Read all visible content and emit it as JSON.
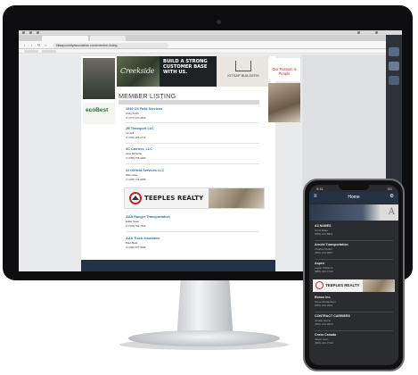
{
  "browser": {
    "url": "kitsapcountyassociation.com/member-listing"
  },
  "banner": {
    "left_brand": "Creekside",
    "middle_text": "BUILD A STRONG CUSTOMER BASE WITH US.",
    "right_text": "KITSAP BUILDERS"
  },
  "page": {
    "heading": "MEMBER LISTING"
  },
  "listings": [
    {
      "name": "1940 Oil Field Services",
      "contact": "Craig Smith",
      "phone": "(377) 417-2840"
    },
    {
      "name": "2B Transport LLC",
      "contact": "Jon Hill",
      "phone": "(503) 206-2713"
    },
    {
      "name": "3C Carriers, LLC",
      "contact": "Jane Richards",
      "phone": "(555) 755-1000"
    },
    {
      "name": "3J Oilfield Services LLC",
      "contact": "Mike Huse",
      "phone": "(405) 726-0055"
    },
    {
      "name": "AAA Ranger Transportation",
      "contact": "Eddie Swan",
      "phone": "(303) 799-7400"
    },
    {
      "name": "AAA Truck Insurance",
      "contact": "Brad Black",
      "phone": "(300) 567-5068"
    }
  ],
  "sponsor": {
    "name": "TEEPLES REALTY"
  },
  "side_ads": {
    "left": "ecoBest",
    "right": "Our Passion is People"
  },
  "phone": {
    "time": "9:41",
    "signal": "5G",
    "title": "Home",
    "banner_letter": "A",
    "listings": [
      {
        "name": "A3 NAMES",
        "contact": "Chris Major",
        "phone": "(555) 213-5811"
      },
      {
        "name": "Arnold Transportation",
        "contact": "Charles Parker",
        "phone": "(555) 213-9867"
      },
      {
        "name": "Aspen",
        "contact": "Logan Williams",
        "phone": "(555) 213-7744"
      }
    ],
    "sponsor": "TEEPLES REALTY",
    "listings_after": [
      {
        "name": "Bonus Inc.",
        "contact": "Steve Richardson",
        "phone": "(555) 213-2011"
      },
      {
        "name": "CONTRACT CARRIERS",
        "contact": "Jordan Harris",
        "phone": "(555) 213-4522"
      },
      {
        "name": "Cross Canada",
        "contact": "Jason Liam",
        "phone": "(555) 213-7744"
      }
    ]
  }
}
